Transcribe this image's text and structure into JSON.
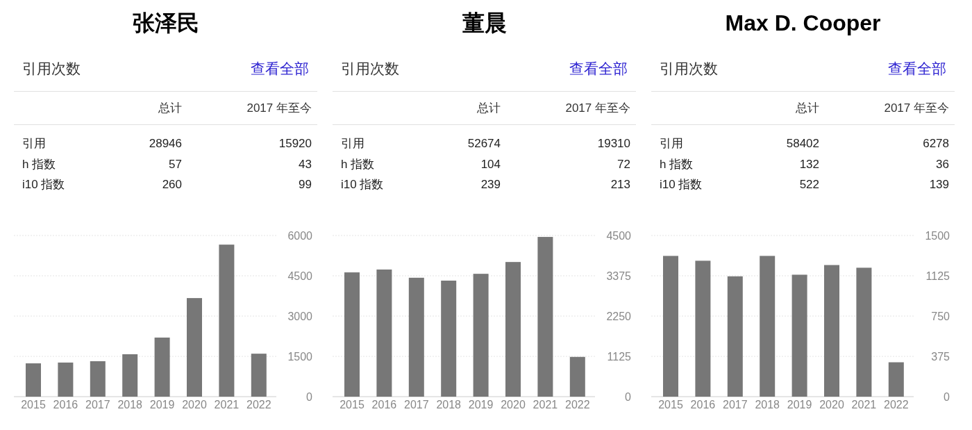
{
  "panels": [
    {
      "title": "张泽民",
      "heading": "引用次数",
      "link": "查看全部",
      "columns": [
        "总计",
        "2017 年至今"
      ],
      "rows": [
        {
          "label": "引用",
          "total": "28946",
          "recent": "15920"
        },
        {
          "label": "h 指数",
          "total": "57",
          "recent": "43"
        },
        {
          "label": "i10 指数",
          "total": "260",
          "recent": "99"
        }
      ],
      "chart_data": {
        "type": "bar",
        "categories": [
          "2015",
          "2016",
          "2017",
          "2018",
          "2019",
          "2020",
          "2021",
          "2022"
        ],
        "values": [
          1240,
          1270,
          1320,
          1580,
          2200,
          3670,
          5660,
          1600
        ],
        "grid": true,
        "ylim": [
          0,
          6000
        ],
        "yticks": [
          0,
          1500,
          3000,
          4500,
          6000
        ]
      }
    },
    {
      "title": "董晨",
      "heading": "引用次数",
      "link": "查看全部",
      "columns": [
        "总计",
        "2017 年至今"
      ],
      "rows": [
        {
          "label": "引用",
          "total": "52674",
          "recent": "19310"
        },
        {
          "label": "h 指数",
          "total": "104",
          "recent": "72"
        },
        {
          "label": "i10 指数",
          "total": "239",
          "recent": "213"
        }
      ],
      "chart_data": {
        "type": "bar",
        "categories": [
          "2015",
          "2016",
          "2017",
          "2018",
          "2019",
          "2020",
          "2021",
          "2022"
        ],
        "values": [
          3470,
          3550,
          3320,
          3240,
          3430,
          3760,
          4460,
          1110
        ],
        "grid": true,
        "ylim": [
          0,
          4500
        ],
        "yticks": [
          0,
          1125,
          2250,
          3375,
          4500
        ]
      }
    },
    {
      "title": "Max D. Cooper",
      "heading": "引用次数",
      "link": "查看全部",
      "columns": [
        "总计",
        "2017 年至今"
      ],
      "rows": [
        {
          "label": "引用",
          "total": "58402",
          "recent": "6278"
        },
        {
          "label": "h 指数",
          "total": "132",
          "recent": "36"
        },
        {
          "label": "i10 指数",
          "total": "522",
          "recent": "139"
        }
      ],
      "chart_data": {
        "type": "bar",
        "categories": [
          "2015",
          "2016",
          "2017",
          "2018",
          "2019",
          "2020",
          "2021",
          "2022"
        ],
        "values": [
          1310,
          1265,
          1120,
          1310,
          1135,
          1225,
          1200,
          320
        ],
        "grid": true,
        "ylim": [
          0,
          1500
        ],
        "yticks": [
          0,
          375,
          750,
          1125,
          1500
        ]
      }
    }
  ]
}
